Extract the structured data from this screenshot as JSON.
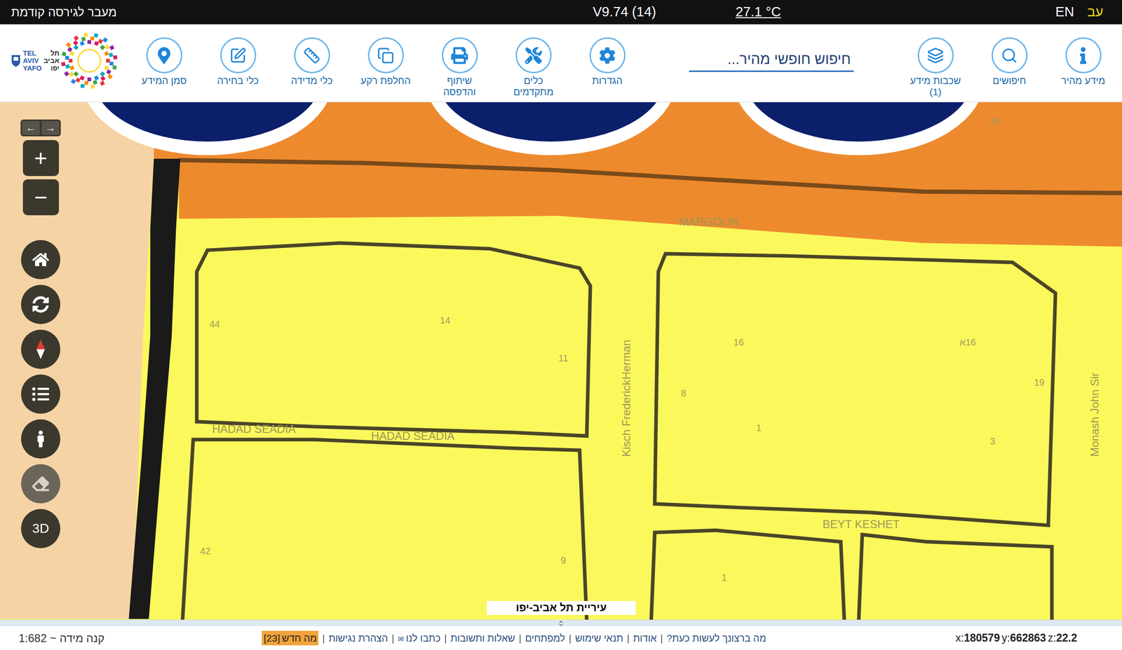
{
  "top_bar": {
    "previous_version": "מעבר לגירסה קודמת",
    "version": "V9.74 (14)",
    "temperature": "27.1 °C",
    "languages": [
      {
        "label": "EN",
        "selected": false
      },
      {
        "label": "עב",
        "selected": true
      }
    ]
  },
  "logo": {
    "text_en": [
      "TEL",
      "AVIV",
      "YAFO"
    ],
    "text_he": [
      "תל",
      "אביב",
      "יפו"
    ]
  },
  "toolbar": {
    "items_right": [
      {
        "label": "מידע מהיר"
      },
      {
        "label": "חיפושים"
      },
      {
        "label": "שכבות מידע",
        "count": "(1)"
      }
    ],
    "search": {
      "placeholder": "חיפוש חופשי מהיר..."
    },
    "items_left": [
      {
        "label": "הגדרות"
      },
      {
        "label": "כלים מתקדמים"
      },
      {
        "label": "שיתוף והדפסה"
      },
      {
        "label": "החלפת רקע"
      },
      {
        "label": "כלי מדידה"
      },
      {
        "label": "כלי בחירה"
      },
      {
        "label": "סמן המידע"
      }
    ]
  },
  "map_controls": {
    "arrows": [
      "←",
      "→"
    ],
    "zoom_in": "+",
    "zoom_out": "−",
    "three_d": "3D"
  },
  "map": {
    "street_labels": [
      "MARGOLIN",
      "HADAD SEADIA",
      "HADAD SEADIA",
      "Kisch FrederickHerman",
      "BEYT KESHET",
      "Monash John Sir"
    ],
    "parcel_numbers": [
      "29",
      "44",
      "14",
      "11",
      "16",
      "16א",
      "8",
      "1",
      "19",
      "3",
      "42",
      "9",
      "1"
    ],
    "attribution": "עיריית תל אביב-יפו"
  },
  "bottom_bar": {
    "scale": "קנה מידה ~ 1:682",
    "separator": "|",
    "links": [
      {
        "label": "מה ברצונך לעשות כעת?",
        "highlighted": false
      },
      {
        "label": "אודות",
        "highlighted": false
      },
      {
        "label": "תנאי שימוש",
        "highlighted": false
      },
      {
        "label": "למפתחים",
        "highlighted": false
      },
      {
        "label": "שאלות ותשובות",
        "highlighted": false
      },
      {
        "label": "כתבו לנו",
        "glyph": "✉",
        "highlighted": false
      },
      {
        "label": "הצהרת נגישות",
        "highlighted": false
      },
      {
        "label": "מה חדש",
        "count": "[23]",
        "highlighted": true
      }
    ],
    "coordinates": [
      {
        "axis": "x:",
        "value": "180579"
      },
      {
        "axis": "y:",
        "value": "662863"
      },
      {
        "axis": "z:",
        "value": "22.2"
      }
    ]
  }
}
